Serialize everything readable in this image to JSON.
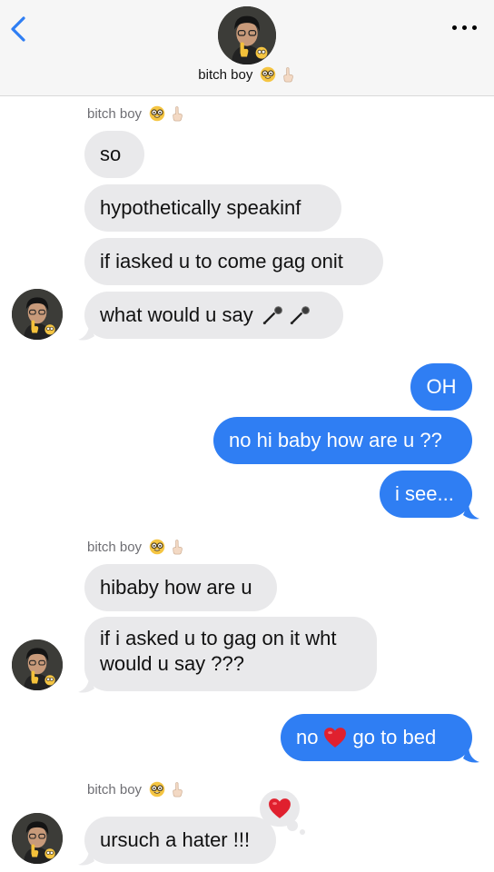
{
  "header": {
    "contact_name": "bitch boy",
    "contact_emojis": [
      "nerd-face-emoji",
      "index-pointing-up-emoji"
    ]
  },
  "colors": {
    "incoming_bubble": "#e9e9eb",
    "outgoing_bubble": "#2f7ef3",
    "back_chevron": "#2f7ef3"
  },
  "messages": {
    "sender_label_1": "bitch boy",
    "m1": "so",
    "m2": "hypothetically speakinf",
    "m3": "if iasked u to come gag onit",
    "m4": "what would u say",
    "m4_emojis": [
      "microphone-emoji",
      "microphone-emoji"
    ],
    "m5": "OH",
    "m6": "no hi baby how are u ??",
    "m7": "i see...",
    "sender_label_2": "bitch boy",
    "m8": "hibaby how are u",
    "m9": "if i asked u to gag on it wht would u say ???",
    "m10_before": "no",
    "m10_emoji": "red-heart-emoji",
    "m10_after": "go to bed",
    "sender_label_3": "bitch boy",
    "m11": "ursuch a hater !!!",
    "m11_tapback": "red-heart-emoji"
  }
}
